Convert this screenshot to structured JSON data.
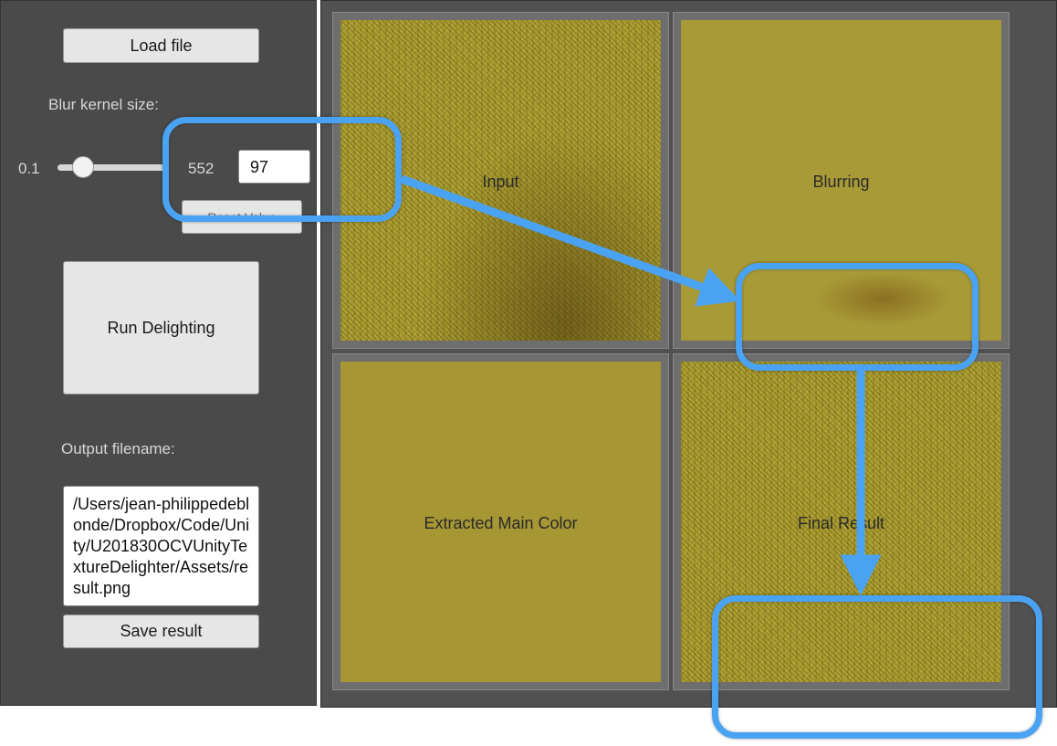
{
  "sidebar": {
    "load_label": "Load file",
    "blur_label": "Blur kernel size:",
    "slider_min": "0.1",
    "slider_max": "552",
    "kernel_value": "97",
    "reset_label": "Reset Value",
    "run_label": "Run Delighting",
    "output_label": "Output filename:",
    "output_path": "/Users/jean-philippedeblonde/Dropbox/Code/Unity/U201830OCVUnityTextureDelighter/Assets/result.png",
    "save_label": "Save result"
  },
  "panels": {
    "input": "Input",
    "blurring": "Blurring",
    "main_color": "Extracted Main Color",
    "final": "Final Result"
  },
  "colors": {
    "panel_bg": "#4a4a4a",
    "highlight": "#4aa3f2",
    "texture_yellow": "#a99a2e"
  }
}
